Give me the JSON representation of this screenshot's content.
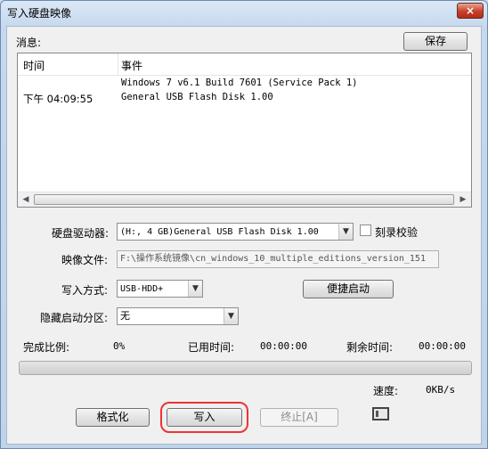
{
  "window": {
    "title": "写入硬盘映像",
    "close_glyph": "×"
  },
  "messages": {
    "label": "消息:",
    "save_button": "保存",
    "columns": {
      "time": "时间",
      "event": "事件"
    },
    "rows": [
      {
        "time": "",
        "event": "Windows 7 v6.1 Build 7601 (Service Pack 1)"
      },
      {
        "time": "下午 04:09:55",
        "event": "General USB Flash Disk  1.00"
      }
    ],
    "scroll_left": "◀",
    "scroll_right": "▶"
  },
  "form": {
    "drive_label": "硬盘驱动器:",
    "drive_value": "(H:, 4 GB)General USB Flash Disk  1.00",
    "verify_label": "刻录校验",
    "verify_checked": false,
    "image_label": "映像文件:",
    "image_value": "F:\\操作系统镜像\\cn_windows_10_multiple_editions_version_151",
    "write_mode_label": "写入方式:",
    "write_mode_value": "USB-HDD+",
    "quick_boot_button": "便捷启动",
    "hidden_partition_label": "隐藏启动分区:",
    "hidden_partition_value": "无",
    "dropdown_glyph": "▼"
  },
  "status": {
    "progress_label": "完成比例:",
    "progress_value": "0%",
    "progress_fraction": 0,
    "elapsed_label": "已用时间:",
    "elapsed_value": "00:00:00",
    "remaining_label": "剩余时间:",
    "remaining_value": "00:00:00",
    "speed_label": "速度:",
    "speed_value": "0KB/s"
  },
  "actions": {
    "format_button": "格式化",
    "write_button": "写入",
    "stop_button": "终止[A]"
  },
  "colors": {
    "highlight": "#e33333",
    "close": "#c7402a"
  }
}
